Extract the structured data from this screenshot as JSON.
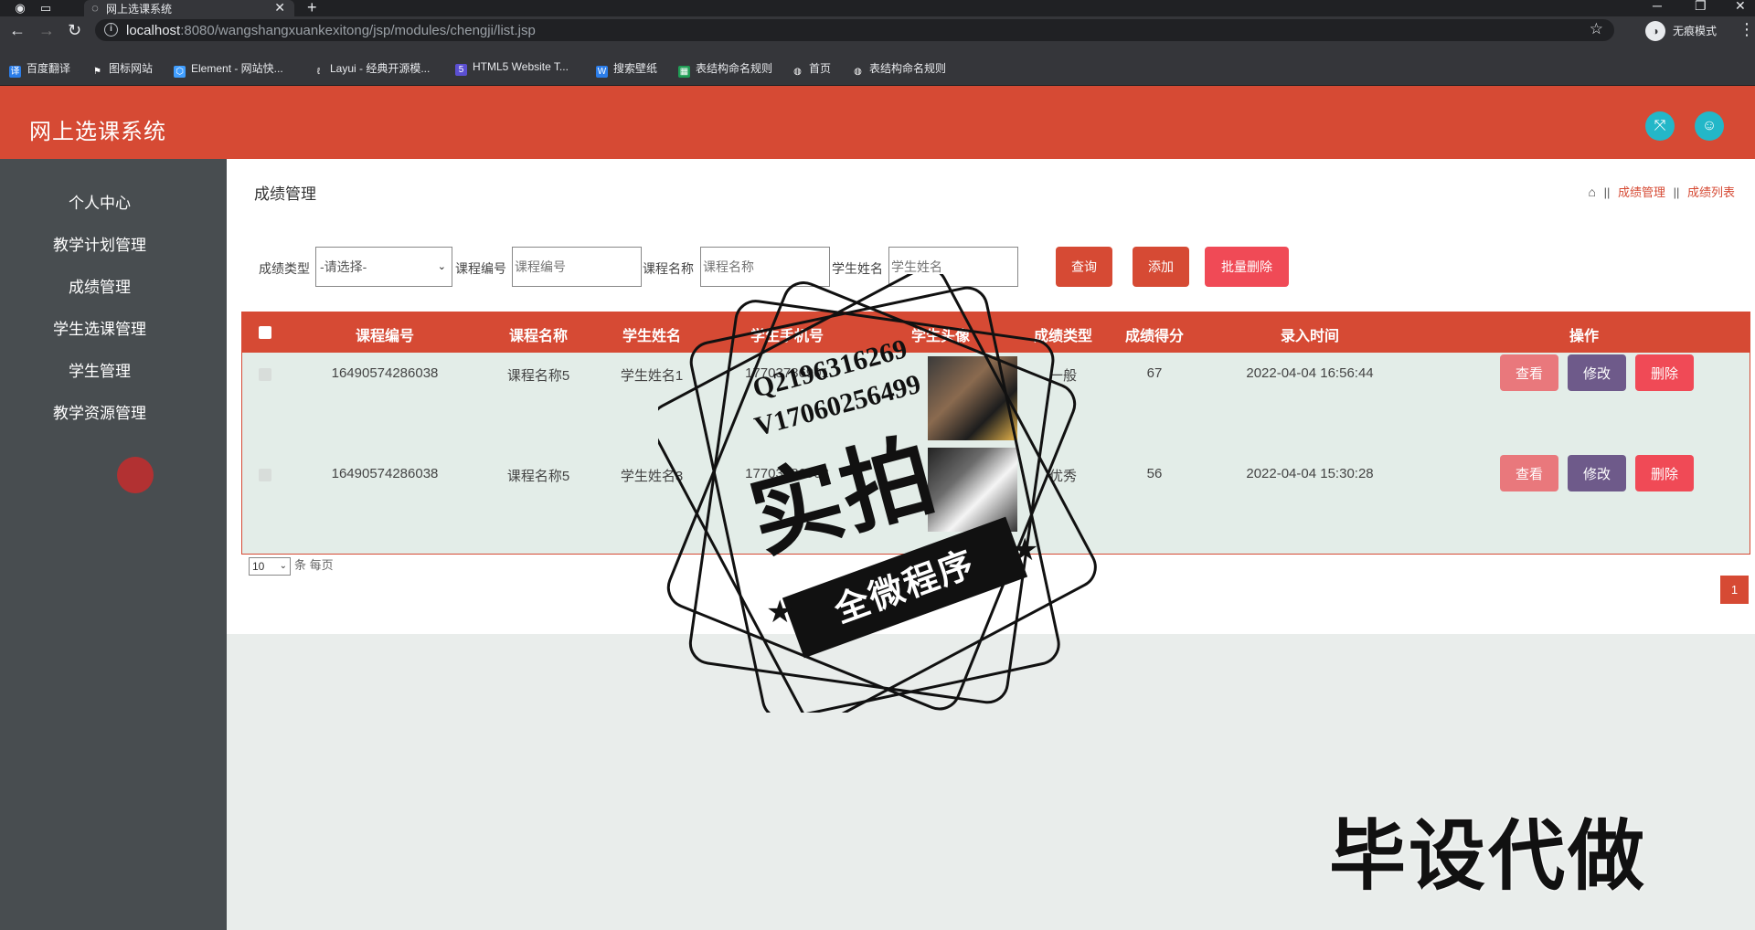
{
  "browser": {
    "tab_title": "网上选课系统",
    "url_host": "localhost",
    "url_path": ":8080/wangshangxuankexitong/jsp/modules/chengji/list.jsp",
    "incognito_label": "无痕模式",
    "bookmarks": [
      {
        "label": "百度翻译",
        "icon": "translate-icon",
        "color": "#2b7de9"
      },
      {
        "label": "图标网站",
        "icon": "flag-icon",
        "color": "#35363a"
      },
      {
        "label": "Element - 网站快...",
        "icon": "element-icon",
        "color": "#409eff"
      },
      {
        "label": "Layui - 经典开源模...",
        "icon": "layui-icon",
        "color": "#35363a"
      },
      {
        "label": "HTML5 Website T...",
        "icon": "html5-icon",
        "color": "#5b4fd1"
      },
      {
        "label": "搜索壁纸",
        "icon": "wallpaper-icon",
        "color": "#2b7de9"
      },
      {
        "label": "表结构命名规则",
        "icon": "table-icon",
        "color": "#1f9d55"
      },
      {
        "label": "首页",
        "icon": "globe-icon",
        "color": "#35363a"
      },
      {
        "label": "表结构命名规则",
        "icon": "globe-icon",
        "color": "#35363a"
      }
    ]
  },
  "app": {
    "title": "网上选课系统",
    "accent": "#d64a34",
    "sidebar_bg": "#484d50"
  },
  "sidebar": {
    "items": [
      {
        "label": "个人中心"
      },
      {
        "label": "教学计划管理"
      },
      {
        "label": "成绩管理"
      },
      {
        "label": "学生选课管理"
      },
      {
        "label": "学生管理"
      },
      {
        "label": "教学资源管理"
      }
    ]
  },
  "main": {
    "page_title": "成绩管理",
    "breadcrumb": [
      "成绩管理",
      "成绩列表"
    ],
    "filters": {
      "type_label": "成绩类型",
      "type_selected": "-请选择-",
      "course_no_label": "课程编号",
      "course_no_placeholder": "课程编号",
      "course_name_label": "课程名称",
      "course_name_placeholder": "课程名称",
      "student_name_label": "学生姓名",
      "student_name_placeholder": "学生姓名"
    },
    "buttons": {
      "query": "查询",
      "add": "添加",
      "batch_delete": "批量删除"
    },
    "table": {
      "headers": [
        "课程编号",
        "课程名称",
        "学生姓名",
        "学生手机号",
        "学生头像",
        "成绩类型",
        "成绩得分",
        "录入时间",
        "操作"
      ],
      "rows": [
        {
          "course_no": "16490574286038",
          "course_name": "课程名称5",
          "student_name": "学生姓名1",
          "phone": "17703786901",
          "score_type": "一般",
          "score": "67",
          "time": "2022-04-04 16:56:44"
        },
        {
          "course_no": "16490574286038",
          "course_name": "课程名称5",
          "student_name": "学生姓名3",
          "phone": "17703786903",
          "score_type": "优秀",
          "score": "56",
          "time": "2022-04-04 15:30:28"
        }
      ],
      "actions": {
        "view": "查看",
        "edit": "修改",
        "delete": "删除"
      }
    },
    "pagination": {
      "page_size": "10",
      "per_page_text": "条 每页",
      "current_page": "1"
    }
  },
  "watermark": {
    "contact_qq": "Q2196316269",
    "contact_v": "V17060256499",
    "big_text": "实拍",
    "ribbon_text": "全微程序",
    "corner_text": "毕设代做"
  }
}
